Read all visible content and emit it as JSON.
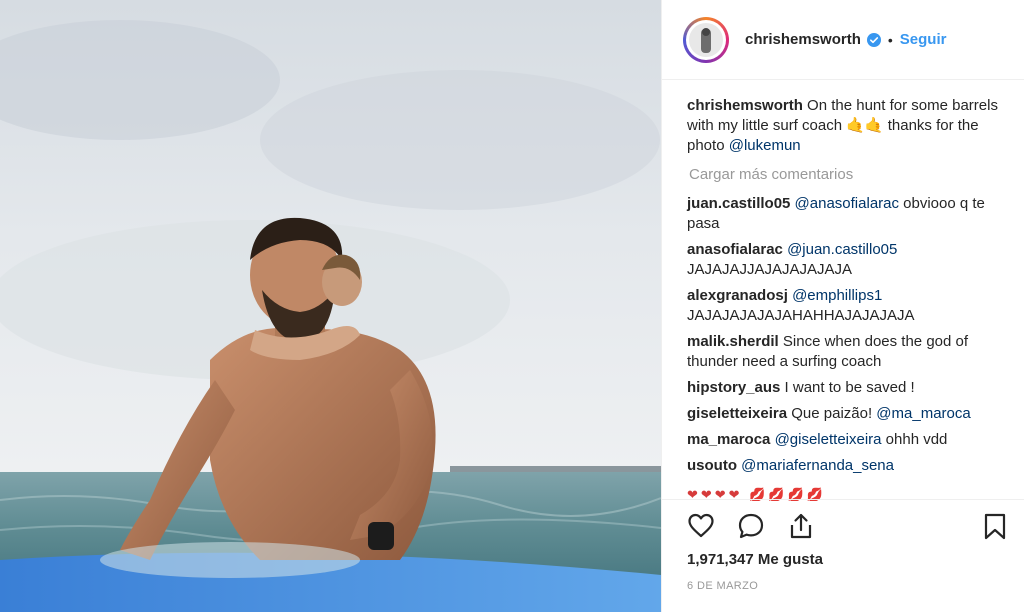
{
  "header": {
    "username": "chrishemsworth",
    "separator": "•",
    "follow_label": "Seguir"
  },
  "caption": {
    "username": "chrishemsworth",
    "text": "On the hunt for some barrels with my little surf coach 🤙🤙 thanks for the photo ",
    "mention": "@lukemun"
  },
  "load_more_label": "Cargar más comentarios",
  "comments": [
    {
      "user": "juan.castillo05",
      "mention": "@anasofialarac",
      "text": " obviooo q te pasa"
    },
    {
      "user": "anasofialarac",
      "mention": "@juan.castillo05",
      "text": " JAJAJAJJAJAJAJAJAJA"
    },
    {
      "user": "alexgranadosj",
      "mention": "@emphillips1",
      "text": " JAJAJAJAJAJAHAHHAJAJAJAJA"
    },
    {
      "user": "malik.sherdil",
      "mention": "",
      "text": "Since when does the god of thunder need a surfing coach"
    },
    {
      "user": "hipstory_aus",
      "mention": "",
      "text": "I want to be saved !"
    },
    {
      "user": "giseletteixeira",
      "mention": "@ma_maroca",
      "text": "Que paizão! "
    },
    {
      "user": "ma_maroca",
      "mention": "@giseletteixeira",
      "text": " ohhh vdd"
    },
    {
      "user": "usouto",
      "mention": "@mariafernanda_sena",
      "text": ""
    }
  ],
  "partial_row_text": "❤❤❤❤ 💋💋💋💋",
  "icons": {
    "like": "heart-icon",
    "comment": "comment-icon",
    "share": "share-icon",
    "save": "bookmark-icon",
    "verified": "verified-badge-icon"
  },
  "likes_label": "1,971,347 Me gusta",
  "date_label": "6 DE MARZO",
  "colors": {
    "link": "#3897f0",
    "mention": "#003569",
    "muted": "#999999",
    "text": "#262626"
  }
}
